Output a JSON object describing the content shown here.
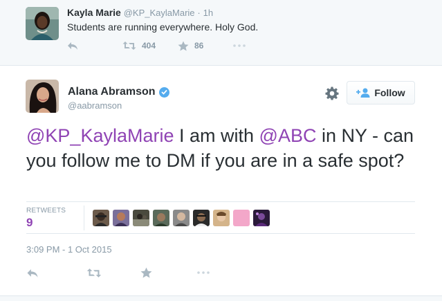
{
  "colors": {
    "mention": "#8f43b4",
    "muted": "#8899a6",
    "icon": "#aab8c2",
    "verified": "#55acee"
  },
  "parent_tweet": {
    "name": "Kayla Marie",
    "handle": "@KP_KaylaMarie",
    "separator": "·",
    "time": "1h",
    "text": "Students are running everywhere. Holy God.",
    "retweets": "404",
    "likes": "86",
    "icons": [
      "reply-icon",
      "retweet-icon",
      "star-icon",
      "more-icon"
    ]
  },
  "tweet": {
    "name": "Alana Abramson",
    "handle": "@aabramson",
    "follow_label": "Follow",
    "text_parts": {
      "mention1": "@KP_KaylaMarie",
      "part1": " I am with ",
      "mention2": "@ABC",
      "part2": " in NY - can you follow me to DM if you are in a safe spot?"
    },
    "retweets_label": "RETWEETS",
    "retweets_count": "9",
    "retweeter_count": 9,
    "date": "3:09 PM - 1 Oct 2015",
    "icons": [
      "reply-icon",
      "retweet-icon",
      "star-icon",
      "more-icon"
    ]
  }
}
